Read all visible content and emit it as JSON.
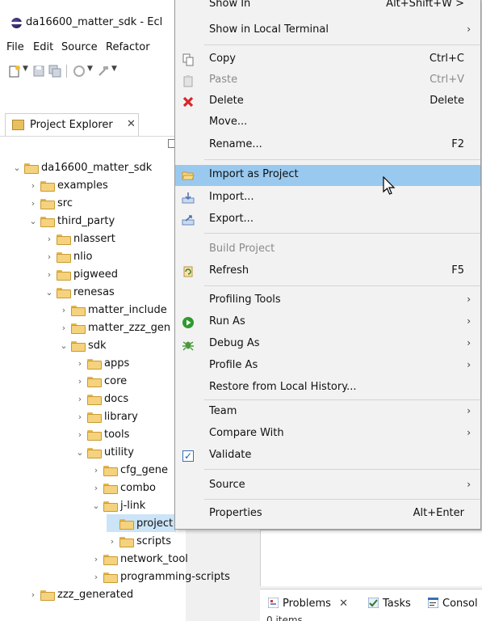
{
  "window": {
    "title": "da16600_matter_sdk - Ecl"
  },
  "menubar": [
    "File",
    "Edit",
    "Source",
    "Refactor"
  ],
  "project_explorer": {
    "tab_label": "Project Explorer",
    "tree": [
      {
        "label": "da16600_matter_sdk",
        "expanded": true
      },
      {
        "label": "examples"
      },
      {
        "label": "src"
      },
      {
        "label": "third_party",
        "expanded": true
      },
      {
        "label": "nlassert"
      },
      {
        "label": "nlio"
      },
      {
        "label": "pigweed"
      },
      {
        "label": "renesas",
        "expanded": true
      },
      {
        "label": "matter_include"
      },
      {
        "label": "matter_zzz_gen"
      },
      {
        "label": "sdk",
        "expanded": true
      },
      {
        "label": "apps"
      },
      {
        "label": "core"
      },
      {
        "label": "docs"
      },
      {
        "label": "library"
      },
      {
        "label": "tools"
      },
      {
        "label": "utility",
        "expanded": true
      },
      {
        "label": "cfg_gene"
      },
      {
        "label": "combo"
      },
      {
        "label": "j-link",
        "expanded": true
      },
      {
        "label": "project",
        "selected": true
      },
      {
        "label": "scripts"
      },
      {
        "label": "network_tool"
      },
      {
        "label": "programming-scripts"
      },
      {
        "label": "zzz_generated"
      }
    ]
  },
  "context_menu": {
    "items": [
      {
        "label": "Show In",
        "shortcut": "Alt+Shift+W >"
      },
      {
        "label": "Show in Local Terminal",
        "arrow": "›"
      },
      {
        "label": "Copy",
        "shortcut": "Ctrl+C",
        "icon": "copy-icon"
      },
      {
        "label": "Paste",
        "shortcut": "Ctrl+V",
        "icon": "paste-icon"
      },
      {
        "label": "Delete",
        "shortcut": "Delete",
        "icon": "delete-icon"
      },
      {
        "label": "Move..."
      },
      {
        "label": "Rename...",
        "shortcut": "F2"
      },
      {
        "label": "Import as Project",
        "icon": "folder-open-icon"
      },
      {
        "label": "Import...",
        "icon": "import-icon"
      },
      {
        "label": "Export...",
        "icon": "export-icon"
      },
      {
        "label": "Build Project"
      },
      {
        "label": "Refresh",
        "shortcut": "F5",
        "icon": "refresh-icon"
      },
      {
        "label": "Profiling Tools",
        "arrow": "›"
      },
      {
        "label": "Run As",
        "arrow": "›",
        "icon": "run-icon"
      },
      {
        "label": "Debug As",
        "arrow": "›",
        "icon": "debug-icon"
      },
      {
        "label": "Profile As",
        "arrow": "›"
      },
      {
        "label": "Restore from Local History..."
      },
      {
        "label": "Team",
        "arrow": "›"
      },
      {
        "label": "Compare With",
        "arrow": "›"
      },
      {
        "label": "Validate",
        "icon": "checkbox-checked-icon"
      },
      {
        "label": "Source",
        "arrow": "›"
      },
      {
        "label": "Properties",
        "shortcut": "Alt+Enter"
      }
    ]
  },
  "bottom_panel": {
    "tabs": [
      "Problems",
      "Tasks",
      "Consol"
    ],
    "items_count": "0 items"
  }
}
